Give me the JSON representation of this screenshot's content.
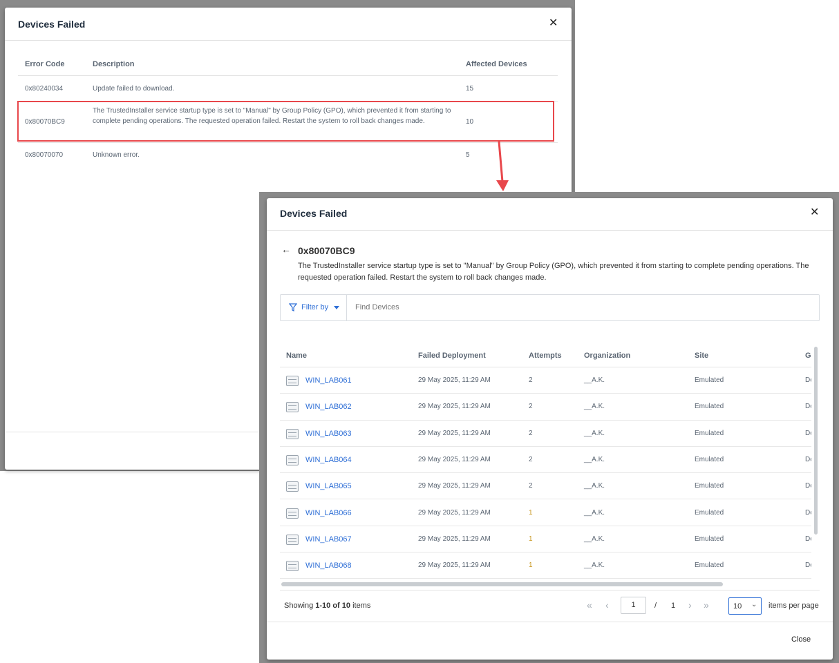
{
  "dialog1": {
    "title": "Devices Failed",
    "columns": {
      "error_code": "Error Code",
      "description": "Description",
      "affected": "Affected Devices"
    },
    "rows": [
      {
        "code": "0x80240034",
        "description": "Update failed to download.",
        "affected": "15"
      },
      {
        "code": "0x80070BC9",
        "description": "The TrustedInstaller service startup type is set to \"Manual\" by Group Policy (GPO), which prevented it from starting to complete pending operations. The requested operation failed. Restart the system to roll back changes made.",
        "affected": "10"
      },
      {
        "code": "0x80070070",
        "description": "Unknown error.",
        "affected": "5"
      }
    ]
  },
  "dialog2": {
    "title": "Devices Failed",
    "error_code": "0x80070BC9",
    "error_description": "The TrustedInstaller service startup type is set to \"Manual\" by Group Policy (GPO), which prevented it from starting to complete pending operations. The requested operation failed. Restart the system to roll back changes made.",
    "filter_label": "Filter by",
    "search_placeholder": "Find Devices",
    "columns": {
      "name": "Name",
      "failed_deployment": "Failed Deployment",
      "attempts": "Attempts",
      "organization": "Organization",
      "site": "Site",
      "group": "Gr"
    },
    "rows": [
      {
        "name": "WIN_LAB061",
        "failed": "29 May 2025, 11:29 AM",
        "attempts": "2",
        "org": "__A.K.",
        "site": "Emulated",
        "group": "De"
      },
      {
        "name": "WIN_LAB062",
        "failed": "29 May 2025, 11:29 AM",
        "attempts": "2",
        "org": "__A.K.",
        "site": "Emulated",
        "group": "De"
      },
      {
        "name": "WIN_LAB063",
        "failed": "29 May 2025, 11:29 AM",
        "attempts": "2",
        "org": "__A.K.",
        "site": "Emulated",
        "group": "De"
      },
      {
        "name": "WIN_LAB064",
        "failed": "29 May 2025, 11:29 AM",
        "attempts": "2",
        "org": "__A.K.",
        "site": "Emulated",
        "group": "De"
      },
      {
        "name": "WIN_LAB065",
        "failed": "29 May 2025, 11:29 AM",
        "attempts": "2",
        "org": "__A.K.",
        "site": "Emulated",
        "group": "De"
      },
      {
        "name": "WIN_LAB066",
        "failed": "29 May 2025, 11:29 AM",
        "attempts": "1",
        "org": "__A.K.",
        "site": "Emulated",
        "group": "De"
      },
      {
        "name": "WIN_LAB067",
        "failed": "29 May 2025, 11:29 AM",
        "attempts": "1",
        "org": "__A.K.",
        "site": "Emulated",
        "group": "De"
      },
      {
        "name": "WIN_LAB068",
        "failed": "29 May 2025, 11:29 AM",
        "attempts": "1",
        "org": "__A.K.",
        "site": "Emulated",
        "group": "De"
      }
    ],
    "pagination": {
      "showing_prefix": "Showing",
      "showing_range": "1-10 of 10",
      "showing_suffix": "items",
      "current_page": "1",
      "separator": "/",
      "total_pages": "1",
      "per_page": "10",
      "per_page_label": "items per page"
    },
    "close_label": "Close"
  },
  "colors": {
    "highlight": "#e8474b",
    "link": "#2f6fd6",
    "attempts_one": "#c8961e"
  },
  "icons": [
    "close-icon",
    "back-arrow-icon",
    "filter-icon",
    "caret-down-icon",
    "device-icon",
    "first-page-icon",
    "prev-page-icon",
    "next-page-icon",
    "last-page-icon"
  ]
}
